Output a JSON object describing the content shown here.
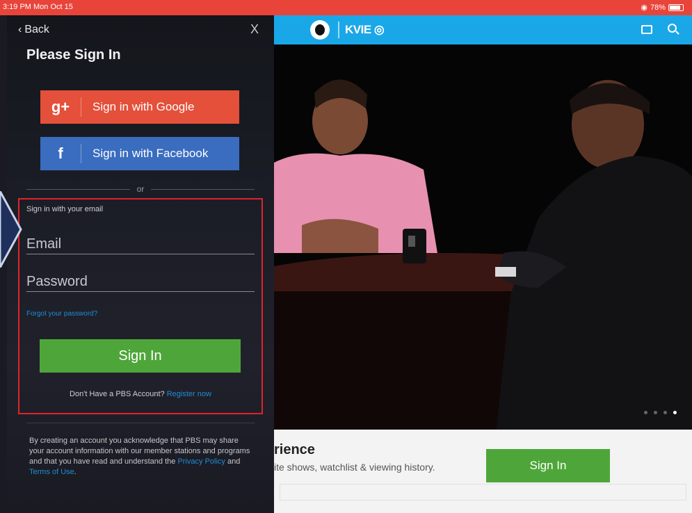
{
  "status_bar": {
    "time": "3:19 PM  Mon Oct 15",
    "battery": "78%"
  },
  "panel": {
    "back_label": "Back",
    "close_label": "X",
    "title": "Please Sign In",
    "google": {
      "icon": "g+",
      "label": "Sign in with Google"
    },
    "facebook": {
      "icon": "f",
      "label": "Sign in with Facebook"
    },
    "or_label": "or",
    "email_note": "Sign in with your email",
    "email_placeholder": "Email",
    "password_placeholder": "Password",
    "forgot_label": "Forgot your password?",
    "sign_in_label": "Sign In",
    "register_prompt": "Don't Have a PBS Account?",
    "register_link": "Register now",
    "legal_text": "By creating an account you acknowledge that PBS may share your account information with our member stations and programs and that you have read and understand the",
    "privacy_link": "Privacy Policy",
    "legal_and": "and",
    "terms_link": "Terms of Use",
    "legal_end": "."
  },
  "app": {
    "brand": "KVIE",
    "promo_title": "rience",
    "promo_sub": "ite shows, watchlist & viewing history.",
    "promo_sign_in": "Sign In",
    "carousel_dots": 4,
    "carousel_active": 3
  },
  "colors": {
    "status_red": "#e8443a",
    "header_blue": "#1aa7e8",
    "google_red": "#e4503a",
    "facebook_blue": "#3a6dbf",
    "signin_green": "#4ea63a",
    "link_blue": "#1e8ed6",
    "highlight_red": "#e0232c"
  }
}
